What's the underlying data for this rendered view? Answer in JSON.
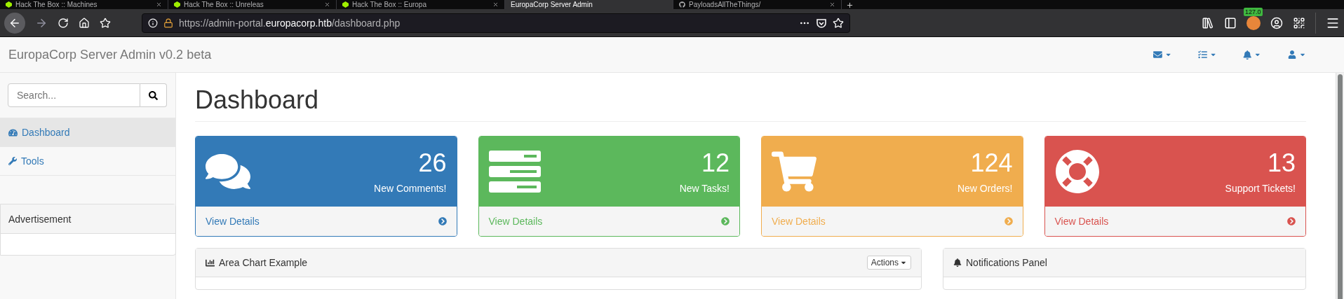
{
  "browser": {
    "tabs": [
      {
        "label": "Hack The Box :: Machines",
        "kind": "htb",
        "selected": false
      },
      {
        "label": "Hack The Box :: Unreleas",
        "kind": "htb",
        "selected": false
      },
      {
        "label": "Hack The Box :: Europa",
        "kind": "htb",
        "selected": false
      },
      {
        "label": "EuropaCorp Server Admin",
        "kind": "plain",
        "selected": true
      },
      {
        "label": "PayloadsAllTheThings/",
        "kind": "github",
        "selected": false
      }
    ],
    "url": {
      "start": "https://admin-portal.",
      "domain": "europacorp.htb",
      "end": "/dashboard.php"
    },
    "extension_badge": "127.0"
  },
  "navbar": {
    "brand": "EuropaCorp Server Admin v0.2 beta",
    "menus": [
      {
        "kind": "envelope"
      },
      {
        "kind": "tasks"
      },
      {
        "kind": "bell"
      },
      {
        "kind": "user"
      }
    ]
  },
  "sidebar": {
    "search": {
      "placeholder": "Search..."
    },
    "items": [
      {
        "label": "Dashboard",
        "kind": "dashboard",
        "selected": true
      },
      {
        "label": "Tools",
        "kind": "wrench",
        "selected": false
      }
    ],
    "advertisement": {
      "title": "Advertisement"
    }
  },
  "page": {
    "title": "Dashboard",
    "cards": [
      {
        "kind": "comments",
        "count": "26",
        "label": "New Comments!",
        "link": "View Details",
        "color": "#337ab7"
      },
      {
        "kind": "tasks",
        "count": "12",
        "label": "New Tasks!",
        "link": "View Details",
        "color": "#5cb85c"
      },
      {
        "kind": "orders",
        "count": "124",
        "label": "New Orders!",
        "link": "View Details",
        "color": "#f0ad4e"
      },
      {
        "kind": "tickets",
        "count": "13",
        "label": "Support Tickets!",
        "link": "View Details",
        "color": "#d9534f"
      }
    ],
    "panels": [
      {
        "kind": "chart",
        "title": "Area Chart Example",
        "action": "Actions"
      },
      {
        "kind": "bell",
        "title": "Notifications Panel"
      }
    ]
  }
}
